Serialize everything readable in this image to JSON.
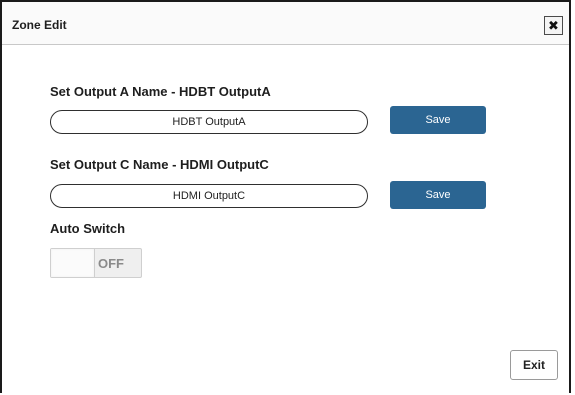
{
  "dialog": {
    "title": "Zone Edit",
    "close_glyph": "✖",
    "close_icon": "close-icon"
  },
  "output_a": {
    "label": "Set Output A Name - HDBT OutputA",
    "value": "HDBT OutputA",
    "save_label": "Save"
  },
  "output_c": {
    "label": "Set Output C Name - HDMI OutputC",
    "value": "HDMI OutputC",
    "save_label": "Save"
  },
  "auto_switch": {
    "label": "Auto Switch",
    "state_text": "OFF",
    "enabled": false
  },
  "footer": {
    "exit_label": "Exit"
  },
  "colors": {
    "save_button": "#2b6592",
    "toggle_off_text": "#8a8a8a"
  }
}
